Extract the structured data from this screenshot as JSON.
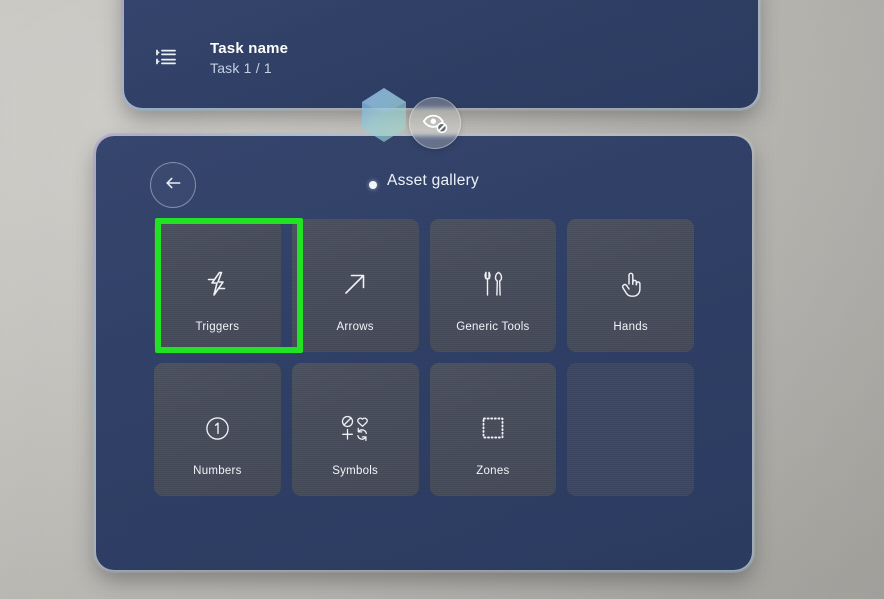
{
  "scene": {
    "background_color": "#c4c2bd",
    "panel_color": "#2f3f66",
    "tile_color": "#4a4f5e",
    "empty_tile_color": "#3d4661",
    "highlight_color": "#22e323"
  },
  "task_panel": {
    "icon": "task-list-icon",
    "title": "Task name",
    "subtitle": "Task 1 / 1"
  },
  "floating": {
    "gem_handle_icon": "gem-handle-icon",
    "visibility_toggle_icon": "eye-off-icon"
  },
  "gallery": {
    "back_button_icon": "arrow-left-icon",
    "title": "Asset gallery",
    "pointer_dot": "cursor-dot",
    "tiles": [
      {
        "label": "Triggers",
        "icon": "lightning-bolt-icon",
        "selected": true,
        "empty": false
      },
      {
        "label": "Arrows",
        "icon": "arrow-up-right-icon",
        "selected": false,
        "empty": false
      },
      {
        "label": "Generic Tools",
        "icon": "tools-icon",
        "selected": false,
        "empty": false
      },
      {
        "label": "Hands",
        "icon": "pointing-hand-icon",
        "selected": false,
        "empty": false
      },
      {
        "label": "Numbers",
        "icon": "circled-one-icon",
        "selected": false,
        "empty": false
      },
      {
        "label": "Symbols",
        "icon": "symbols-grid-icon",
        "selected": false,
        "empty": false
      },
      {
        "label": "Zones",
        "icon": "dashed-square-icon",
        "selected": false,
        "empty": false
      },
      {
        "label": "",
        "icon": "",
        "selected": false,
        "empty": true
      }
    ]
  }
}
